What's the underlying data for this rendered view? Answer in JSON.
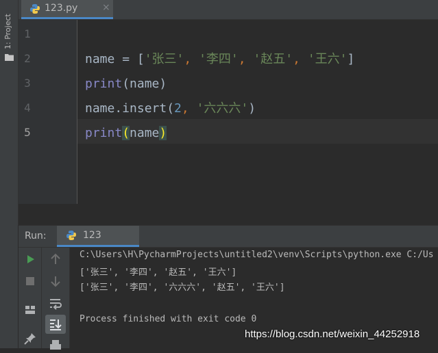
{
  "sidebar": {
    "project_label": "1: Project"
  },
  "editor_tab": {
    "filename": "123.py",
    "close_glyph": "×"
  },
  "editor": {
    "line_numbers": [
      "1",
      "2",
      "3",
      "4",
      "5"
    ],
    "current_line": "5",
    "lines": {
      "l2": {
        "ident": "name",
        "op": " = [",
        "s1": "'张三'",
        "s2": "'李四'",
        "s3": "'赵五'",
        "s4": "'王六'",
        "sep": ", ",
        "close": "]"
      },
      "l3": {
        "func": "print",
        "args": "(name)"
      },
      "l4": {
        "obj": "name.insert(",
        "num": "2",
        "sep": ", ",
        "str": "'六六六'",
        "close": ")"
      },
      "l5": {
        "func": "print",
        "open": "(",
        "arg": "name",
        "close": ")"
      }
    }
  },
  "run_panel": {
    "label": "Run:",
    "tab_name": "123",
    "console": [
      "C:\\Users\\H\\PycharmProjects\\untitled2\\venv\\Scripts\\python.exe C:/Us",
      "['张三', '李四', '赵五', '王六']",
      "['张三', '李四', '六六六', '赵五', '王六']",
      "",
      "Process finished with exit code 0"
    ]
  },
  "watermark": "https://blog.csdn.net/weixin_44252918",
  "colors": {
    "accent": "#4a88c7",
    "keyword_print": "#8888c6",
    "string": "#6a8759",
    "number": "#6897bb",
    "comma": "#cc7832",
    "run_green": "#499c54"
  }
}
